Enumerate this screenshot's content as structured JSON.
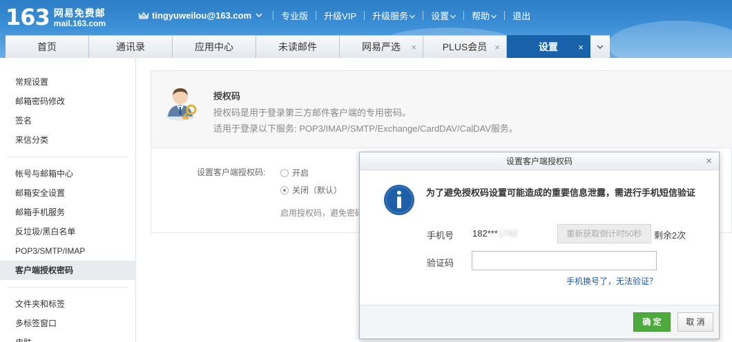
{
  "header": {
    "logo_number": "163",
    "logo_title": "网易免费邮",
    "logo_domain": "mail.163.com",
    "user_email": "tingyuweilou@163.com",
    "nav": [
      "专业版",
      "升级VIP",
      "升级服务",
      "设置",
      "帮助",
      "退出"
    ]
  },
  "tabs": [
    {
      "label": "首页"
    },
    {
      "label": "通讯录"
    },
    {
      "label": "应用中心"
    },
    {
      "label": "未读邮件"
    },
    {
      "label": "网易严选",
      "closable": true
    },
    {
      "label": "PLUS会员",
      "closable": true
    },
    {
      "label": "设置",
      "closable": true,
      "active": true
    }
  ],
  "tab_close_glyph": "×",
  "sidebar": {
    "group1": [
      "常规设置",
      "邮箱密码修改",
      "签名",
      "来信分类"
    ],
    "group2": [
      "帐号与邮箱中心",
      "邮箱安全设置",
      "邮箱手机服务",
      "反垃圾/黑白名单",
      "POP3/SMTP/IMAP",
      "客户端授权密码"
    ],
    "group3": [
      "文件夹和标签",
      "多标签窗口",
      "皮肤"
    ]
  },
  "panel": {
    "title": "授权码",
    "desc1": "授权码是用于登录第三方邮件客户端的专用密码。",
    "desc2": "适用于登录以下服务: POP3/IMAP/SMTP/Exchange/CardDAV/CalDAV服务。",
    "form_label": "设置客户端授权码:",
    "option_on": "开启",
    "option_off": "关闭（默认）",
    "hint": "启用授权码，避免密码"
  },
  "modal": {
    "title": "设置客户端授权码",
    "close_glyph": "×",
    "message": "为了避免授权码设置可能造成的重要信息泄露，需进行手机短信验证",
    "phone_label": "手机号",
    "phone_prefix": "182***",
    "phone_suffix": "1742",
    "resend_label": "重新获取倒计时50秒",
    "remaining": "剩余2次",
    "code_label": "验证码",
    "code_value": "",
    "changed_phone_link": "手机换号了，无法验证？",
    "ok_label": "确 定",
    "cancel_label": "取 消"
  },
  "colors": {
    "header_blue": "#2c7ec7",
    "active_tab": "#1862ac",
    "ok_green": "#4daa3c",
    "link_blue": "#1c55a8",
    "info_icon_blue": "#1d5fa8"
  }
}
